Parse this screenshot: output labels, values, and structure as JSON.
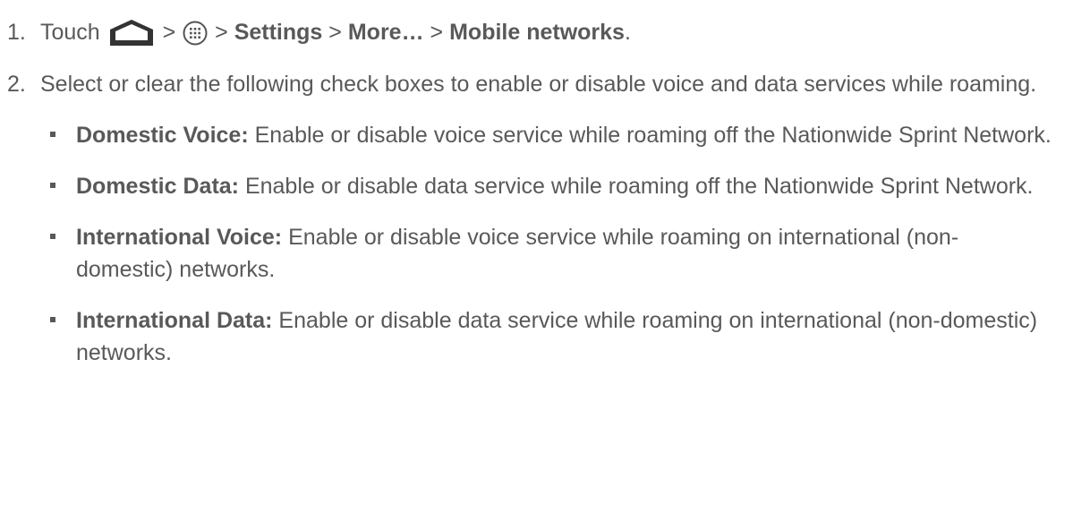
{
  "steps": [
    {
      "number": "1.",
      "prefix": "Touch",
      "home_icon": "home-icon",
      "apps_icon": "apps-icon",
      "sep": ">",
      "settings": "Settings",
      "more": "More…",
      "mobile_networks": "Mobile networks",
      "period": "."
    },
    {
      "number": "2.",
      "text": "Select or clear the following check boxes to enable or disable voice and data services while roaming."
    }
  ],
  "bullets": [
    {
      "label": "Domestic Voice:",
      "text": " Enable or disable voice service while roaming off the Nationwide Sprint Network."
    },
    {
      "label": "Domestic Data:",
      "text": " Enable or disable data service while roaming off the Nationwide Sprint Network."
    },
    {
      "label": "International Voice:",
      "text": " Enable or disable voice service while roaming on international (non-domestic) networks."
    },
    {
      "label": "International Data:",
      "text": " Enable or disable data service while roaming on international (non-domestic) networks."
    }
  ],
  "colors": {
    "text": "#595959",
    "icon": "#333333"
  }
}
